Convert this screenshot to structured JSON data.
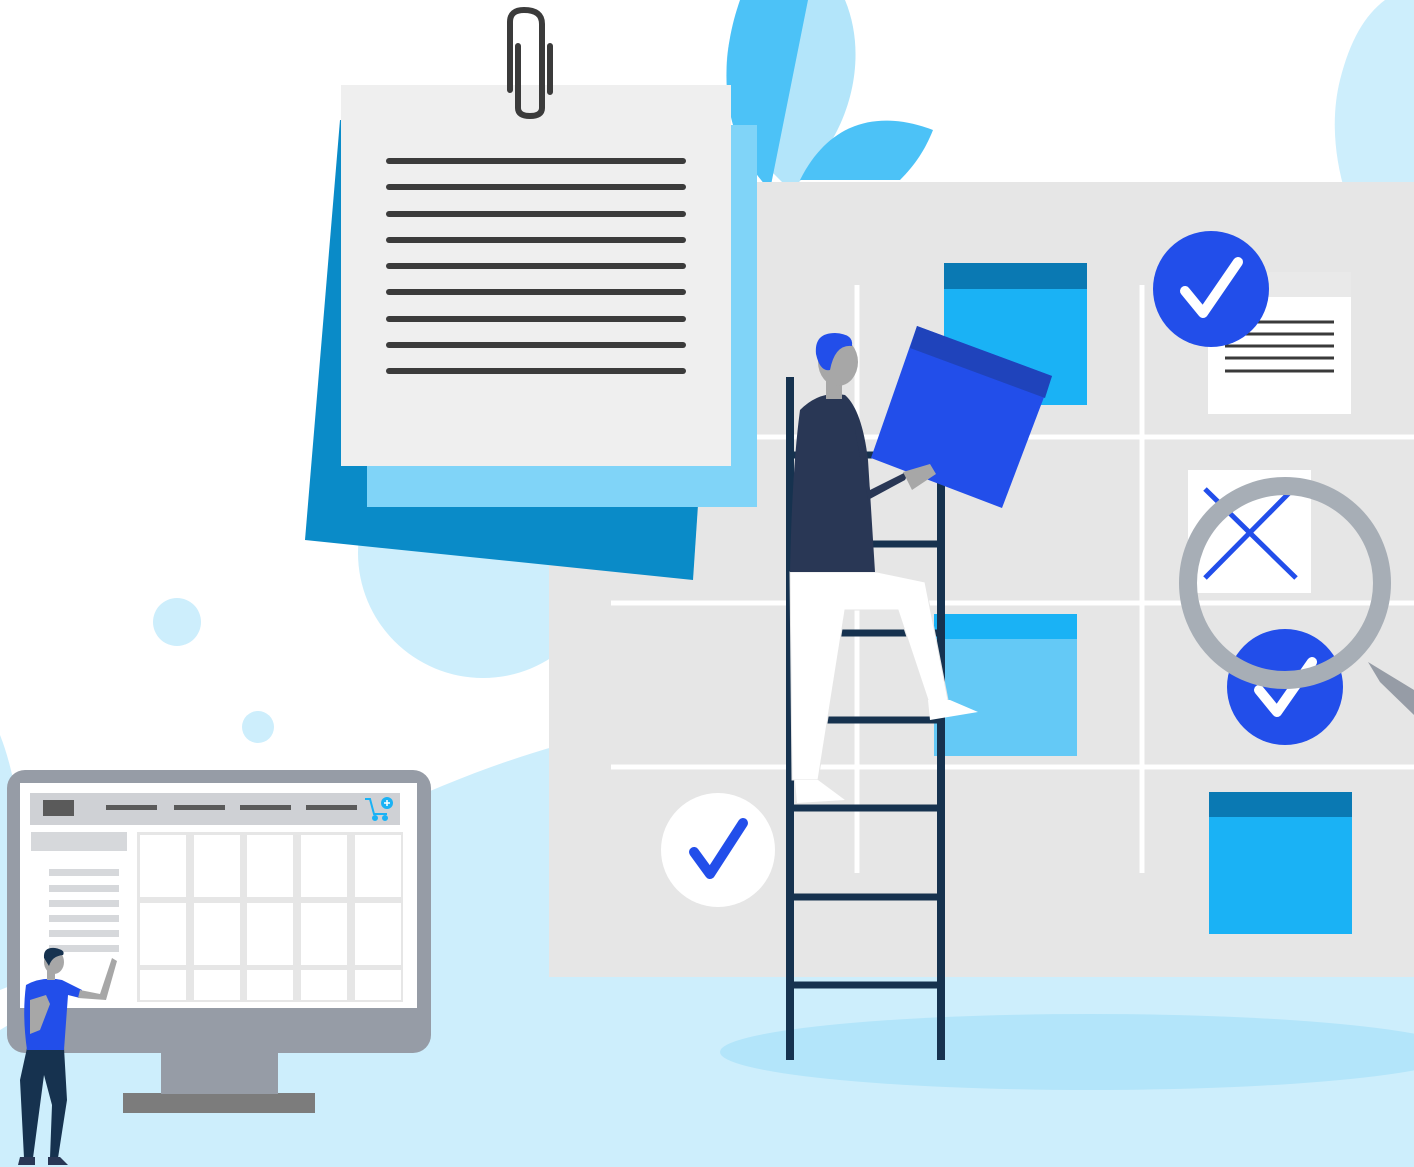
{
  "scene": {
    "title": "",
    "colors": {
      "background": "#ffffff",
      "sky_light": "#cdeefc",
      "sky_mid": "#b3e5fa",
      "leaf": "#4cc2f7",
      "board": "#e6e6e6",
      "note_paper": "#efefef",
      "note_back_dark": "#0a8bc8",
      "note_back_light": "#80d4f8",
      "card_blue": "#1ab2f5",
      "card_header": "#0a79b3",
      "check_blue": "#224eea",
      "navy": "#293755",
      "ladder": "#16324f",
      "monitor_frame": "#969ca6",
      "cart_accent": "#1ab2f5"
    },
    "icons": [
      "paperclip-icon",
      "checkmark-icon",
      "cross-icon",
      "magnifier-icon",
      "shopping-cart-add-icon"
    ],
    "board": {
      "check_states": [
        "done",
        "done",
        "done"
      ],
      "rejected_count": 1
    }
  }
}
